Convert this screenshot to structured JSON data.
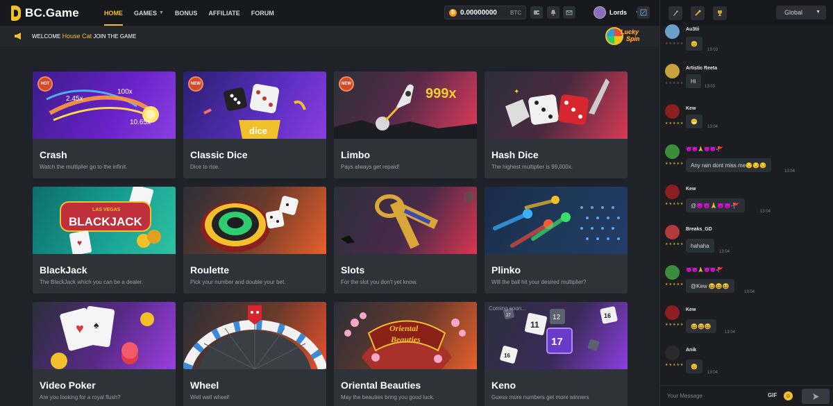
{
  "logo": {
    "text": "BC.Game"
  },
  "nav": [
    {
      "label": "HOME",
      "active": true
    },
    {
      "label": "GAMES",
      "active": false,
      "dropdown": true
    },
    {
      "label": "BONUS",
      "active": false
    },
    {
      "label": "AFFILIATE",
      "active": false
    },
    {
      "label": "FORUM",
      "active": false
    }
  ],
  "wallet": {
    "amount": "0.00000000",
    "currency": "BTC",
    "coin_glyph": "₿"
  },
  "user": {
    "name": "Lords"
  },
  "welcome": {
    "prefix": "WELCOME",
    "name": "House Cat",
    "suffix": "JOIN THE GAME"
  },
  "lucky_spin": {
    "line1": "Lucky",
    "line2": "Spin"
  },
  "games": [
    {
      "title": "Crash",
      "desc": "Watch the multiplier go to the infinit.",
      "badge": "HOT",
      "art": {
        "mults": [
          "2.45x",
          "100x",
          "10.65x"
        ]
      }
    },
    {
      "title": "Classic Dice",
      "desc": "Dice to rise.",
      "badge": "NEW",
      "art": {
        "label": "dice"
      }
    },
    {
      "title": "Limbo",
      "desc": "Pays always get repaid!",
      "badge": "NEW",
      "art": {
        "mult": "999x"
      }
    },
    {
      "title": "Hash Dice",
      "desc": "The highest multiplier is 99,000x.",
      "badge": ""
    },
    {
      "title": "BlackJack",
      "desc": "The BlackJack which you can be a dealer.",
      "badge": "",
      "art": {
        "sign_top": "LAS VEGAS",
        "sign_main": "BLACKJACK"
      }
    },
    {
      "title": "Roulette",
      "desc": "Pick your number and double your bet.",
      "badge": ""
    },
    {
      "title": "Slots",
      "desc": "For the slot you don't yet know.",
      "badge": ""
    },
    {
      "title": "Plinko",
      "desc": "Will the ball hit your desired multiplier?",
      "badge": ""
    },
    {
      "title": "Video Poker",
      "desc": "Are you looking for a royal flush?",
      "badge": ""
    },
    {
      "title": "Wheel",
      "desc": "Well well wheel!",
      "badge": ""
    },
    {
      "title": "Oriental Beauties",
      "desc": "May the beauties bring you good luck.",
      "badge": "",
      "art": {
        "sign_line1": "Oriental",
        "sign_line2": "Beauties"
      }
    },
    {
      "title": "Keno",
      "desc": "Guess more numbers get more winners",
      "badge": "",
      "art": {
        "coming": "Coming soon...",
        "tiles": [
          "27",
          "11",
          "12",
          "16",
          "17",
          "16"
        ]
      }
    }
  ],
  "chat": {
    "channel": "Global",
    "placeholder": "Your Message",
    "gif_label": "GIF",
    "tab_icons": [
      "rocket-icon",
      "fire-icon",
      "trophy-icon"
    ],
    "messages": [
      {
        "name": "Au3tii",
        "text": "😊",
        "time": "13:03",
        "stars": "★★★★★",
        "avatar_color": "#6aa0c8"
      },
      {
        "name": "Artistic Reeta",
        "text": "Hi",
        "time": "13:03",
        "stars": "★★★★★",
        "avatar_color": "#c9a13a"
      },
      {
        "name": "Kew",
        "text": "😁",
        "time": "13:04",
        "stars": "★★★★★",
        "avatar_color": "#8b1e1e"
      },
      {
        "name": "😈😈🙏😈😈-🚩",
        "text": "Any rain dont miss me😒😒😒",
        "time": "13:04",
        "stars": "★★★★★",
        "avatar_color": "#3d8b3d"
      },
      {
        "name": "Kew",
        "text": "@😈😈🙏😈😈-🚩",
        "time": "13:04",
        "stars": "★★★★★",
        "avatar_color": "#8b1e1e"
      },
      {
        "name": "Breaks_GD",
        "text": "hahaha",
        "time": "13:04",
        "stars": "★★★★★",
        "avatar_color": "#b23a3a"
      },
      {
        "name": "😈😈🙏😈😈-🚩",
        "text": "@Kew 😆😆😆",
        "time": "13:04",
        "stars": "★★★★★",
        "avatar_color": "#3d8b3d"
      },
      {
        "name": "Kew",
        "text": "😆😆😆",
        "time": "13:04",
        "stars": "★★★★★",
        "avatar_color": "#8b1e1e"
      },
      {
        "name": "Anik",
        "text": "😊",
        "time": "13:04",
        "stars": "★★★★★",
        "avatar_color": "#2a2a2a"
      }
    ]
  },
  "colors": {
    "accent": "#f2c02b",
    "bg": "#1f2228",
    "card": "#2e3239"
  }
}
